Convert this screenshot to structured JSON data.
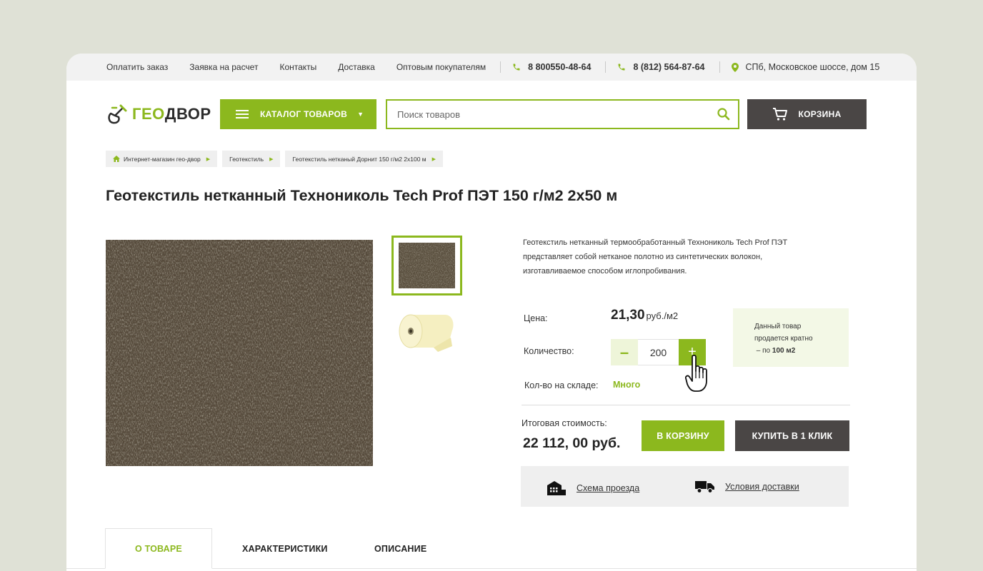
{
  "topbar": {
    "links": [
      "Оплатить заказ",
      "Заявка на расчет",
      "Контакты",
      "Доставка",
      "Оптовым покупателям"
    ],
    "phone1": "8 800550-48-64",
    "phone2": "8 (812) 564-87-64",
    "address": "СПб, Московское шоссе, дом 15"
  },
  "logo": {
    "part1": "ГЕО",
    "part2": "ДВОР"
  },
  "header": {
    "catalog_label": "КАТАЛОГ ТОВАРОВ",
    "search_placeholder": "Поиск товаров",
    "cart_label": "КОРЗИНА"
  },
  "breadcrumbs": [
    "Интернет-магазин гео-двор",
    "Геотекстиль",
    "Геотекстиль нетканый Дорнит 150 г/м2 2х100 м"
  ],
  "product": {
    "title": "Геотекстиль нетканный Технониколь Tech Prof ПЭТ 150 г/м2 2х50 м",
    "description": "Геотекстиль нетканный термообработанный Технониколь Tech Prof ПЭТ представляет собой нетканое полотно из синтетических волокон, изготавливаемое способом иглопробивания.",
    "price_label": "Цена:",
    "price_value": "21,30",
    "price_unit": "руб./м2",
    "qty_label": "Количество:",
    "qty_value": "200",
    "qty_minus": "–",
    "qty_plus": "+",
    "stock_label": "Кол-во на складе:",
    "stock_value": "Много",
    "note_line1": "Данный товар",
    "note_line2": "продается кратно",
    "note_prefix": "– по",
    "note_amount": "100 м2",
    "total_label": "Итоговая стоимость:",
    "total_value": "22 112, 00 руб.",
    "add_to_cart": "В КОРЗИНУ",
    "buy_one_click": "КУПИТЬ В 1 КЛИК",
    "route_scheme": "Схема проезда",
    "delivery_terms": "Условия доставки"
  },
  "tabs": [
    "О ТОВАРЕ",
    "ХАРАКТЕРИСТИКИ",
    "ОПИСАНИЕ"
  ],
  "colors": {
    "accent": "#8cb81e",
    "dark": "#4a4645",
    "background": "#dfe1d6"
  }
}
